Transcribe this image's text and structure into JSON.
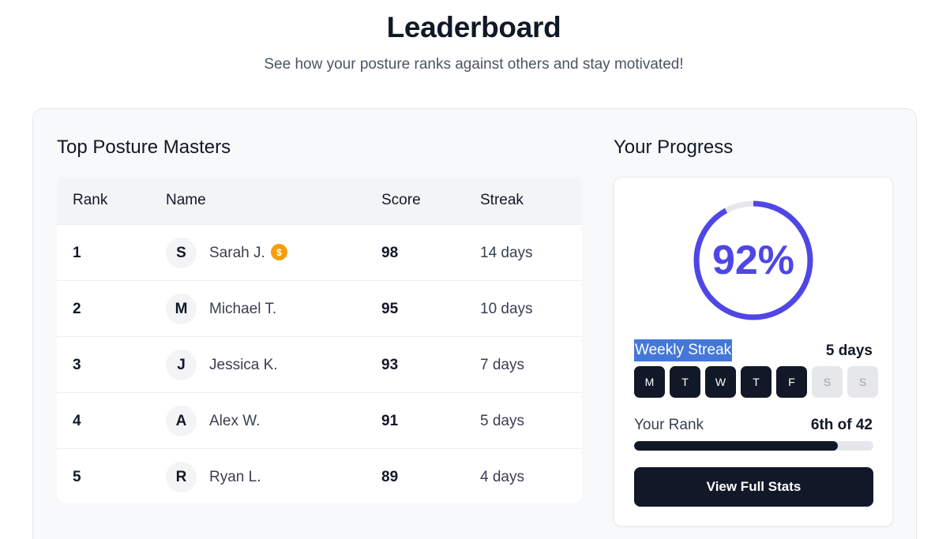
{
  "header": {
    "title": "Leaderboard",
    "subtitle": "See how your posture ranks against others and stay motivated!"
  },
  "leaderboard": {
    "title": "Top Posture Masters",
    "columns": [
      "Rank",
      "Name",
      "Score",
      "Streak"
    ],
    "rows": [
      {
        "rank": "1",
        "initial": "S",
        "name": "Sarah J.",
        "score": "98",
        "streak": "14 days",
        "badge_icon": "gold-coin-icon",
        "badge_glyph": "$"
      },
      {
        "rank": "2",
        "initial": "M",
        "name": "Michael T.",
        "score": "95",
        "streak": "10 days"
      },
      {
        "rank": "3",
        "initial": "J",
        "name": "Jessica K.",
        "score": "93",
        "streak": "7 days"
      },
      {
        "rank": "4",
        "initial": "A",
        "name": "Alex W.",
        "score": "91",
        "streak": "5 days"
      },
      {
        "rank": "5",
        "initial": "R",
        "name": "Ryan L.",
        "score": "89",
        "streak": "4 days"
      }
    ]
  },
  "progress": {
    "title": "Your Progress",
    "score_label": "92%",
    "score_fraction": 0.92,
    "weekly_streak_label": "Weekly Streak",
    "weekly_streak_value": "5 days",
    "days": [
      {
        "label": "M",
        "active": true
      },
      {
        "label": "T",
        "active": true
      },
      {
        "label": "W",
        "active": true
      },
      {
        "label": "T",
        "active": true
      },
      {
        "label": "F",
        "active": true
      },
      {
        "label": "S",
        "active": false
      },
      {
        "label": "S",
        "active": false
      }
    ],
    "rank_label": "Your Rank",
    "rank_value": "6th of 42",
    "rank_fraction": 0.85,
    "button_label": "View Full Stats"
  },
  "colors": {
    "accent": "#4f46e5",
    "ring_track": "#e5e7eb",
    "dark": "#111827",
    "badge": "#f59e0b",
    "selection_highlight": "#4577d8"
  }
}
